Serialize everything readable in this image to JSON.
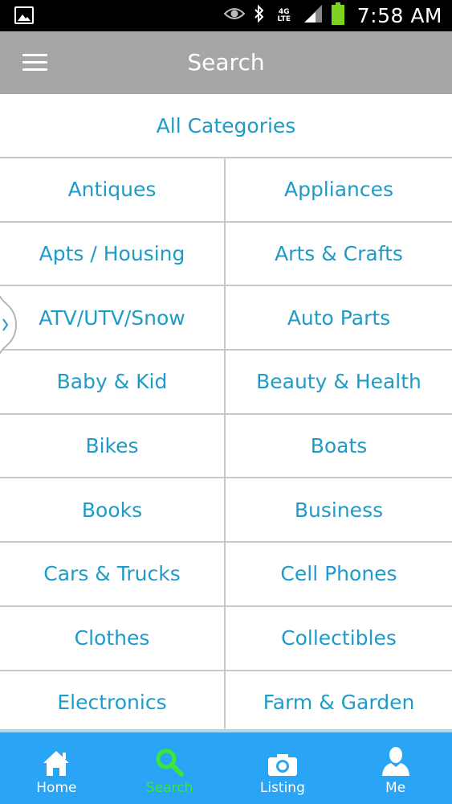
{
  "status_bar": {
    "time": "7:58 AM",
    "network": "4G LTE",
    "colors": {
      "battery": "#7ed321"
    }
  },
  "header": {
    "title": "Search",
    "background": "#a6a6a6"
  },
  "categories": {
    "all_label": "All Categories",
    "items": [
      "Antiques",
      "Appliances",
      "Apts / Housing",
      "Arts & Crafts",
      "ATV/UTV/Snow",
      "Auto Parts",
      "Baby & Kid",
      "Beauty & Health",
      "Bikes",
      "Boats",
      "Books",
      "Business",
      "Cars & Trucks",
      "Cell Phones",
      "Clothes",
      "Collectibles",
      "Electronics",
      "Farm & Garden"
    ],
    "text_color": "#1e9bc8"
  },
  "bottom_nav": {
    "items": [
      {
        "label": "Home",
        "icon": "home-icon"
      },
      {
        "label": "Search",
        "icon": "search-icon",
        "active": true
      },
      {
        "label": "Listing",
        "icon": "camera-icon"
      },
      {
        "label": "Me",
        "icon": "user-icon"
      }
    ],
    "background": "#2aa4f4",
    "active_color": "#39e639"
  }
}
